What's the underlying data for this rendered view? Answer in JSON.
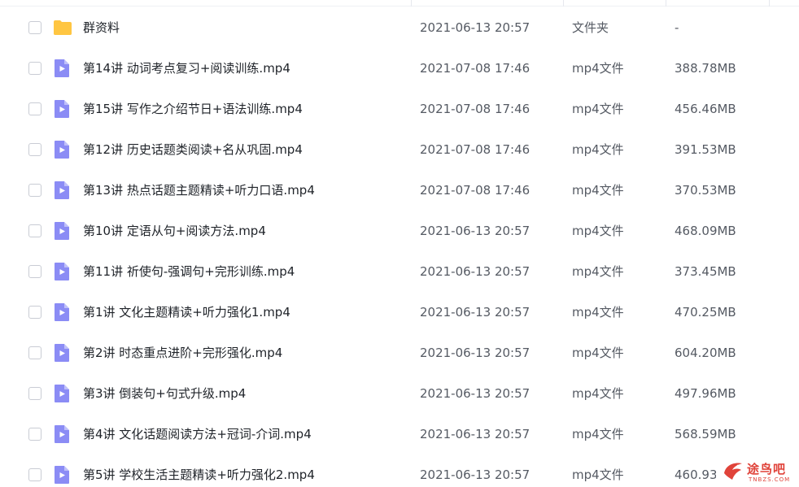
{
  "colors": {
    "folder": "#FFC542",
    "video_file": "#8B8CF5",
    "watermark": "#E0433A"
  },
  "rows": [
    {
      "icon": "folder-icon",
      "name": "群资料",
      "date": "2021-06-13 20:57",
      "type": "文件夹",
      "size": "-"
    },
    {
      "icon": "video-file-icon",
      "name": "第14讲 动词考点复习+阅读训练.mp4",
      "date": "2021-07-08 17:46",
      "type": "mp4文件",
      "size": "388.78MB"
    },
    {
      "icon": "video-file-icon",
      "name": "第15讲 写作之介绍节日+语法训练.mp4",
      "date": "2021-07-08 17:46",
      "type": "mp4文件",
      "size": "456.46MB"
    },
    {
      "icon": "video-file-icon",
      "name": "第12讲 历史话题类阅读+名从巩固.mp4",
      "date": "2021-07-08 17:46",
      "type": "mp4文件",
      "size": "391.53MB"
    },
    {
      "icon": "video-file-icon",
      "name": "第13讲 热点话题主题精读+听力口语.mp4",
      "date": "2021-07-08 17:46",
      "type": "mp4文件",
      "size": "370.53MB"
    },
    {
      "icon": "video-file-icon",
      "name": "第10讲 定语从句+阅读方法.mp4",
      "date": "2021-06-13 20:57",
      "type": "mp4文件",
      "size": "468.09MB"
    },
    {
      "icon": "video-file-icon",
      "name": "第11讲 祈使句-强调句+完形训练.mp4",
      "date": "2021-06-13 20:57",
      "type": "mp4文件",
      "size": "373.45MB"
    },
    {
      "icon": "video-file-icon",
      "name": "第1讲 文化主题精读+听力强化1.mp4",
      "date": "2021-06-13 20:57",
      "type": "mp4文件",
      "size": "470.25MB"
    },
    {
      "icon": "video-file-icon",
      "name": "第2讲 时态重点进阶+完形强化.mp4",
      "date": "2021-06-13 20:57",
      "type": "mp4文件",
      "size": "604.20MB"
    },
    {
      "icon": "video-file-icon",
      "name": "第3讲 倒装句+句式升级.mp4",
      "date": "2021-06-13 20:57",
      "type": "mp4文件",
      "size": "497.96MB"
    },
    {
      "icon": "video-file-icon",
      "name": "第4讲 文化话题阅读方法+冠词-介词.mp4",
      "date": "2021-06-13 20:57",
      "type": "mp4文件",
      "size": "568.59MB"
    },
    {
      "icon": "video-file-icon",
      "name": "第5讲 学校生活主题精读+听力强化2.mp4",
      "date": "2021-06-13 20:57",
      "type": "mp4文件",
      "size": "460.93"
    }
  ],
  "watermark": {
    "text": "途鸟吧",
    "sub": "TNBZS.COM"
  }
}
